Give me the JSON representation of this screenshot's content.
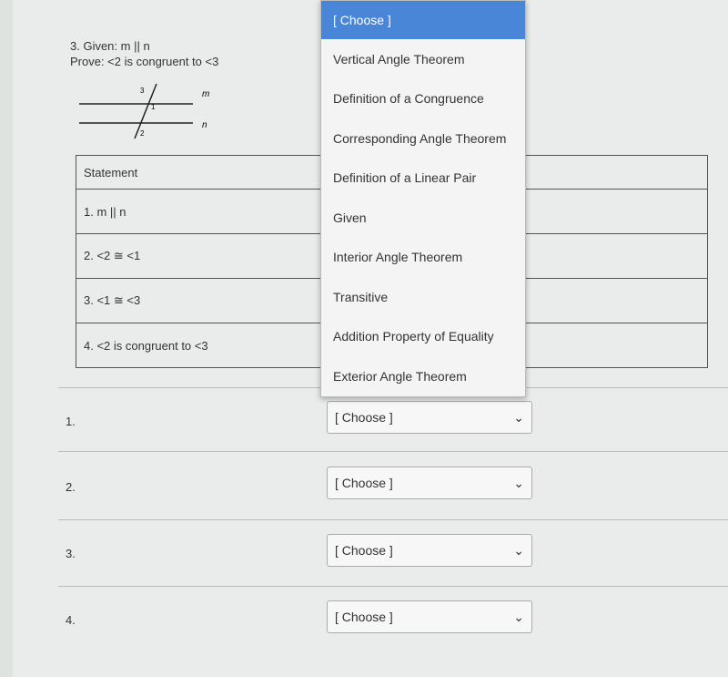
{
  "question": {
    "given": "3. Given: m || n",
    "prove": "Prove: <2 is congruent to <3"
  },
  "diagram": {
    "labels": [
      "3",
      "1",
      "2",
      "m",
      "n"
    ]
  },
  "table": {
    "header": "Statement",
    "rows": [
      "1. m || n",
      "2. <2 ≅ <1",
      "3. <1 ≅ <3",
      "4. <2 is congruent to <3"
    ]
  },
  "dropdown_menu": {
    "options": [
      "[ Choose ]",
      "Vertical Angle Theorem",
      "Definition of a Congruence",
      "Corresponding Angle Theorem",
      "Definition of a Linear Pair",
      "Given",
      "Interior Angle Theorem",
      "Transitive",
      "Addition Property of Equality",
      "Exterior Angle Theorem"
    ],
    "highlighted": "[ Choose ]",
    "highlight_color": "#4a86d8"
  },
  "answers": [
    {
      "num": "1.",
      "value": "[ Choose ]"
    },
    {
      "num": "2.",
      "value": "[ Choose ]"
    },
    {
      "num": "3.",
      "value": "[ Choose ]"
    },
    {
      "num": "4.",
      "value": "[ Choose ]"
    }
  ]
}
